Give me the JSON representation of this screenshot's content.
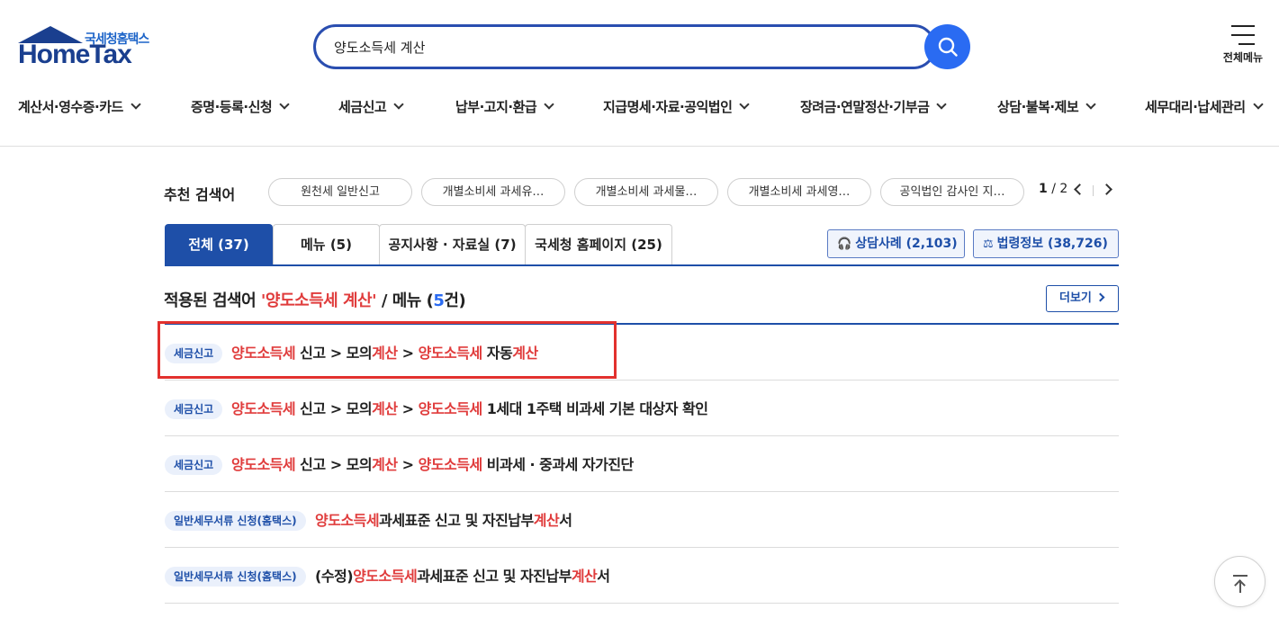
{
  "header": {
    "logo_sub": "국세청홈택스",
    "logo_main": "HomeTax",
    "search_value": "양도소득세 계산",
    "all_menu_label": "전체메뉴"
  },
  "gnb": [
    {
      "label": "계산서·영수증·카드"
    },
    {
      "label": "증명·등록·신청"
    },
    {
      "label": "세금신고"
    },
    {
      "label": "납부·고지·환급"
    },
    {
      "label": "지급명세·자료·공익법인"
    },
    {
      "label": "장려금·연말정산·기부금"
    },
    {
      "label": "상담·불복·제보"
    },
    {
      "label": "세무대리·납세관리"
    }
  ],
  "recommend": {
    "label": "추천 검색어",
    "chips": [
      "원천세 일반신고",
      "개별소비세 과세유…",
      "개별소비세 과세물…",
      "개별소비세 과세영…",
      "공익법인 감사인 지…"
    ],
    "page_current": "1",
    "page_total": "/ 2"
  },
  "tabs": [
    {
      "label": "전체 (37)",
      "active": true
    },
    {
      "label": "메뉴 (5)",
      "active": false
    },
    {
      "label": "공지사항 · 자료실 (7)",
      "active": false
    },
    {
      "label": "국세청 홈페이지 (25)",
      "active": false
    }
  ],
  "side_buttons": {
    "consult": "상담사례 (2,103)",
    "law": "법령정보 (38,726)"
  },
  "result": {
    "prefix": "적용된 검색어 ",
    "query": "'양도소득세 계산'",
    "middle": " / 메뉴 (",
    "count": "5",
    "suffix": "건)",
    "more_label": "더보기"
  },
  "rows": [
    {
      "badge": "세금신고",
      "parts": [
        [
          "양도소득세",
          true
        ],
        [
          " 신고 > 모의",
          false
        ],
        [
          "계산",
          true
        ],
        [
          " > ",
          false
        ],
        [
          "양도소득세",
          true
        ],
        [
          " 자동",
          false
        ],
        [
          "계산",
          true
        ]
      ]
    },
    {
      "badge": "세금신고",
      "parts": [
        [
          "양도소득세",
          true
        ],
        [
          " 신고 > 모의",
          false
        ],
        [
          "계산",
          true
        ],
        [
          " > ",
          false
        ],
        [
          "양도소득세",
          true
        ],
        [
          " 1세대 1주택 비과세 기본 대상자 확인",
          false
        ]
      ]
    },
    {
      "badge": "세금신고",
      "parts": [
        [
          "양도소득세",
          true
        ],
        [
          " 신고 > 모의",
          false
        ],
        [
          "계산",
          true
        ],
        [
          " > ",
          false
        ],
        [
          "양도소득세",
          true
        ],
        [
          " 비과세 · 중과세 자가진단",
          false
        ]
      ]
    },
    {
      "badge": "일반세무서류 신청(홈택스)",
      "parts": [
        [
          "양도소득세",
          true
        ],
        [
          "과세표준 신고 및 자진납부",
          false
        ],
        [
          "계산",
          true
        ],
        [
          "서",
          false
        ]
      ]
    },
    {
      "badge": "일반세무서류 신청(홈택스)",
      "parts": [
        [
          "(수정)",
          false
        ],
        [
          "양도소득세",
          true
        ],
        [
          "과세표준 신고 및 자진납부",
          false
        ],
        [
          "계산",
          true
        ],
        [
          "서",
          false
        ]
      ]
    }
  ],
  "colors": {
    "primary": "#1e4fa8",
    "search_button": "#2a6bf2",
    "keyword_highlight": "#e03c3c",
    "annotation_box": "#e2312e"
  }
}
